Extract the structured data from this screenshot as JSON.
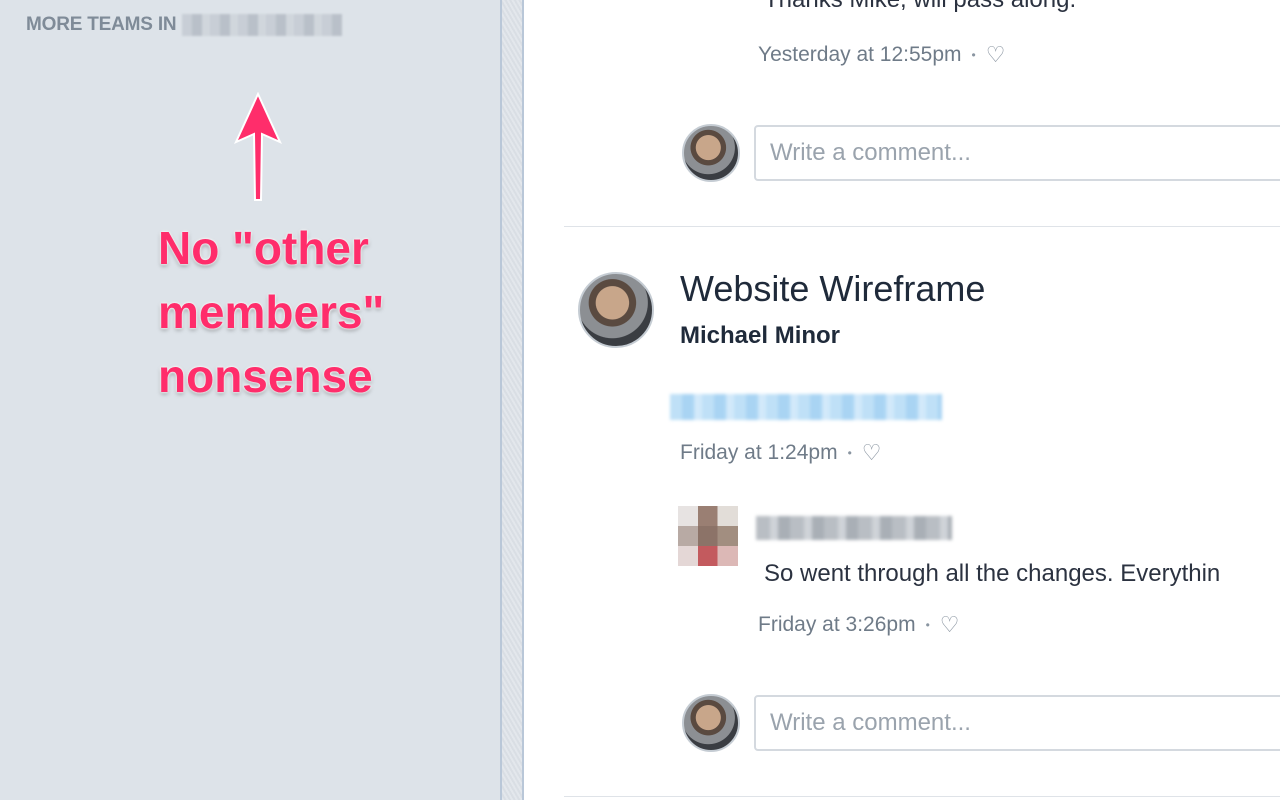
{
  "sidebar": {
    "teams_header": "MORE TEAMS IN",
    "annotation": {
      "text": "No \"other\nmembers\"\nnonsense",
      "color": "#ff2d6b"
    }
  },
  "feed": {
    "previous_comment": {
      "text": "Thanks Mike, will pass along.",
      "timestamp": "Yesterday at 12:55pm"
    },
    "comment_input_placeholder": "Write a comment...",
    "post": {
      "title": "Website Wireframe",
      "author": "Michael Minor",
      "timestamp": "Friday at 1:24pm",
      "comment": {
        "text": "So went through all the changes. Everythin",
        "timestamp": "Friday at 3:26pm"
      },
      "comment_input_placeholder": "Write a comment..."
    },
    "separator_glyph": "•",
    "heart_glyph": "♡"
  }
}
